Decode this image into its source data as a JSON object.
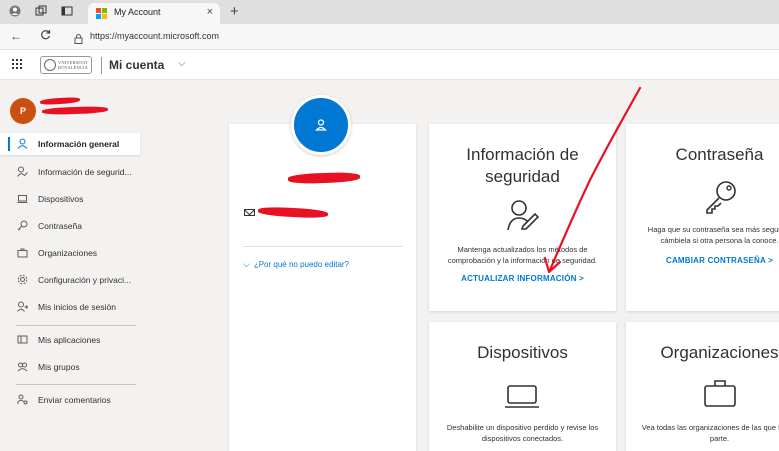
{
  "browser": {
    "tab_title": "My Account",
    "tab_close": "×",
    "new_tab": "+",
    "url": "https://myaccount.microsoft.com",
    "back": "←",
    "reload": "C"
  },
  "header": {
    "university_name_line1": "VNIVERSITAT",
    "university_name_line2": "DÖVALÈNCIA",
    "app_name": "Mi cuenta",
    "app_chevron": "⌵"
  },
  "user": {
    "initial": "P",
    "avatar_color": "#ca5010"
  },
  "sidebar": {
    "items": [
      {
        "label": "Información general",
        "icon": "person-icon",
        "glyph": "⚲"
      },
      {
        "label": "Información de segurid...",
        "icon": "security-info-icon",
        "glyph": "⚿"
      },
      {
        "label": "Dispositivos",
        "icon": "laptop-icon",
        "glyph": "▭"
      },
      {
        "label": "Contraseña",
        "icon": "key-icon",
        "glyph": "⚷"
      },
      {
        "label": "Organizaciones",
        "icon": "briefcase-icon",
        "glyph": "⛶"
      },
      {
        "label": "Configuración y privaci...",
        "icon": "gear-icon",
        "glyph": "⚙"
      },
      {
        "label": "Mis inicios de sesión",
        "icon": "sign-ins-icon",
        "glyph": "⚲"
      },
      {
        "label": "Mis aplicaciones",
        "icon": "apps-icon",
        "glyph": "▣"
      },
      {
        "label": "Mis grupos",
        "icon": "groups-icon",
        "glyph": "⚇"
      },
      {
        "label": "Enviar comentarios",
        "icon": "feedback-icon",
        "glyph": "⚲"
      }
    ]
  },
  "profile": {
    "why_cant_edit": "¿Por qué no puedo editar?",
    "why_chevron": "⌵"
  },
  "tiles": {
    "security": {
      "title_line1": "Información de",
      "title_line2": "seguridad",
      "desc_line1": "Mantenga actualizados los métodos de",
      "desc_line2": "comprobación y la información de seguridad.",
      "link": "ACTUALIZAR INFORMACIÓN  >"
    },
    "password": {
      "title": "Contraseña",
      "desc_line1": "Haga que su contraseña sea más segura o",
      "desc_line2": "cámbiela si otra persona la conoce.",
      "link": "CAMBIAR CONTRASEÑA  >"
    },
    "devices": {
      "title": "Dispositivos",
      "desc_line1": "Deshabilite un dispositivo perdido y revise los",
      "desc_line2": "dispositivos conectados."
    },
    "organizations": {
      "title": "Organizaciones",
      "desc_line1": "Vea todas las organizaciones de las que forma",
      "desc_line2": "parte."
    }
  },
  "colors": {
    "accent": "#0078d4",
    "annotation": "#e81123",
    "background": "#f3f2f1"
  }
}
